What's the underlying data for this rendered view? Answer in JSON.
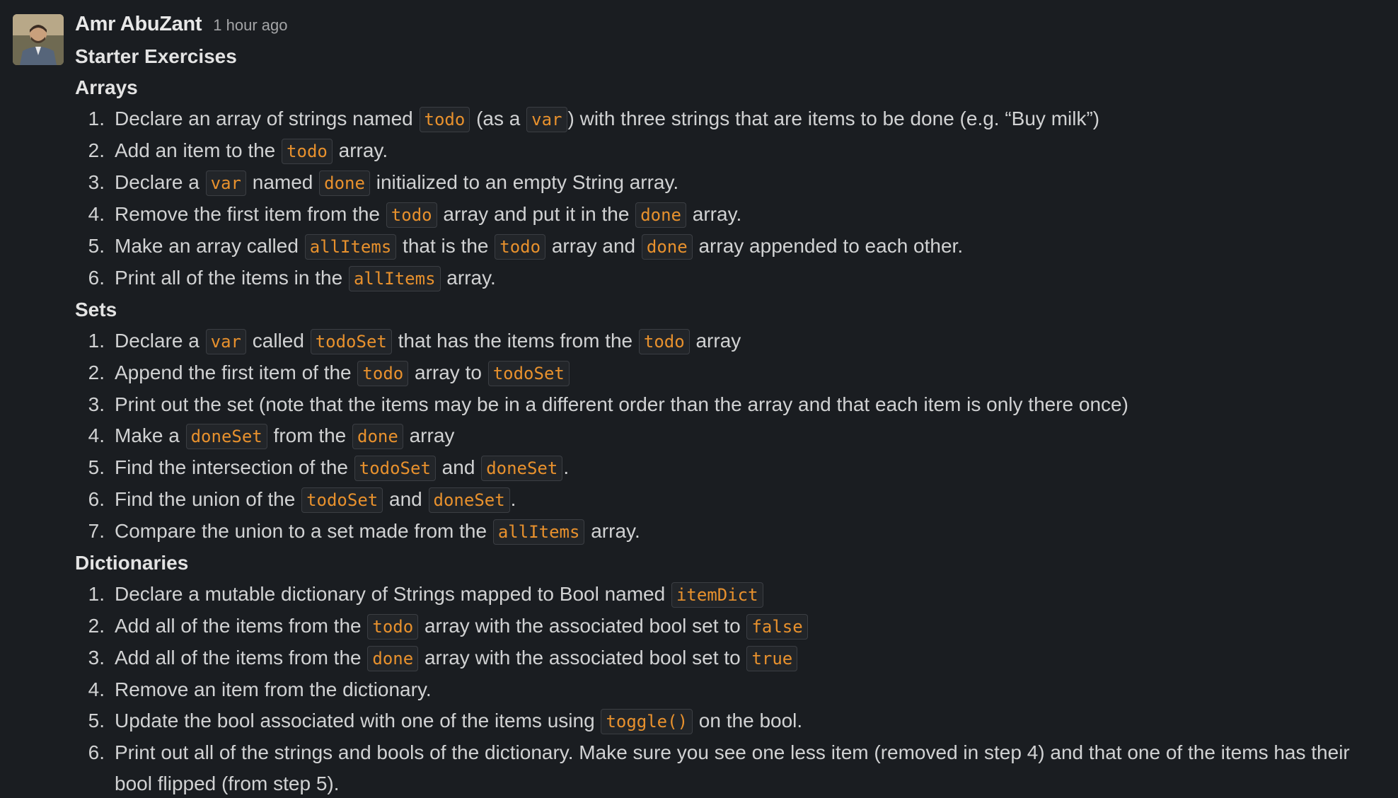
{
  "message": {
    "author": "Amr AbuZant",
    "timestamp": "1 hour ago",
    "title": "Starter Exercises"
  },
  "sections": [
    {
      "heading": "Arrays",
      "items": [
        [
          {
            "t": "Declare an array of strings named "
          },
          {
            "c": "todo"
          },
          {
            "t": " (as a "
          },
          {
            "c": "var"
          },
          {
            "t": ") with three strings that are items to be done (e.g. “Buy milk”)"
          }
        ],
        [
          {
            "t": "Add an item to the "
          },
          {
            "c": "todo"
          },
          {
            "t": " array."
          }
        ],
        [
          {
            "t": "Declare a "
          },
          {
            "c": "var"
          },
          {
            "t": " named "
          },
          {
            "c": "done"
          },
          {
            "t": " initialized to an empty String array."
          }
        ],
        [
          {
            "t": "Remove the first item from the "
          },
          {
            "c": "todo"
          },
          {
            "t": " array and put it in the "
          },
          {
            "c": "done"
          },
          {
            "t": " array."
          }
        ],
        [
          {
            "t": "Make an array called "
          },
          {
            "c": "allItems"
          },
          {
            "t": " that is the "
          },
          {
            "c": "todo"
          },
          {
            "t": " array and "
          },
          {
            "c": "done"
          },
          {
            "t": " array appended to each other."
          }
        ],
        [
          {
            "t": "Print all of the items in the "
          },
          {
            "c": "allItems"
          },
          {
            "t": " array."
          }
        ]
      ]
    },
    {
      "heading": "Sets",
      "items": [
        [
          {
            "t": "Declare a "
          },
          {
            "c": "var"
          },
          {
            "t": " called "
          },
          {
            "c": "todoSet"
          },
          {
            "t": " that has the items from the "
          },
          {
            "c": "todo"
          },
          {
            "t": " array"
          }
        ],
        [
          {
            "t": "Append the first item of the "
          },
          {
            "c": "todo"
          },
          {
            "t": " array to "
          },
          {
            "c": "todoSet"
          }
        ],
        [
          {
            "t": "Print out the set (note that the items may be in a different order than the array and that each item is only there once)"
          }
        ],
        [
          {
            "t": "Make a "
          },
          {
            "c": "doneSet"
          },
          {
            "t": " from the "
          },
          {
            "c": "done"
          },
          {
            "t": " array"
          }
        ],
        [
          {
            "t": "Find the intersection of the "
          },
          {
            "c": "todoSet"
          },
          {
            "t": " and "
          },
          {
            "c": "doneSet"
          },
          {
            "t": "."
          }
        ],
        [
          {
            "t": "Find the union of the "
          },
          {
            "c": "todoSet"
          },
          {
            "t": " and "
          },
          {
            "c": "doneSet"
          },
          {
            "t": "."
          }
        ],
        [
          {
            "t": "Compare the union to a set made from the "
          },
          {
            "c": "allItems"
          },
          {
            "t": " array."
          }
        ]
      ]
    },
    {
      "heading": "Dictionaries",
      "items": [
        [
          {
            "t": "Declare a mutable dictionary of Strings mapped to Bool named "
          },
          {
            "c": "itemDict"
          }
        ],
        [
          {
            "t": "Add all of the items from the "
          },
          {
            "c": "todo"
          },
          {
            "t": " array with the associated bool set to "
          },
          {
            "c": "false"
          }
        ],
        [
          {
            "t": "Add all of the items from the "
          },
          {
            "c": "done"
          },
          {
            "t": " array with the associated bool set to "
          },
          {
            "c": "true"
          }
        ],
        [
          {
            "t": "Remove an item from the dictionary."
          }
        ],
        [
          {
            "t": "Update the bool associated with one of the items using "
          },
          {
            "c": "toggle()"
          },
          {
            "t": " on the bool."
          }
        ],
        [
          {
            "t": "Print out all of the strings and bools of the dictionary. Make sure you see one less item (removed in step 4) and that one of the items has their bool flipped (from step 5)."
          }
        ]
      ]
    }
  ],
  "colors": {
    "background": "#1a1d21",
    "text": "#d1d2d3",
    "code_text": "#e8912d",
    "code_background": "#222529",
    "code_border": "#3b3e43"
  }
}
